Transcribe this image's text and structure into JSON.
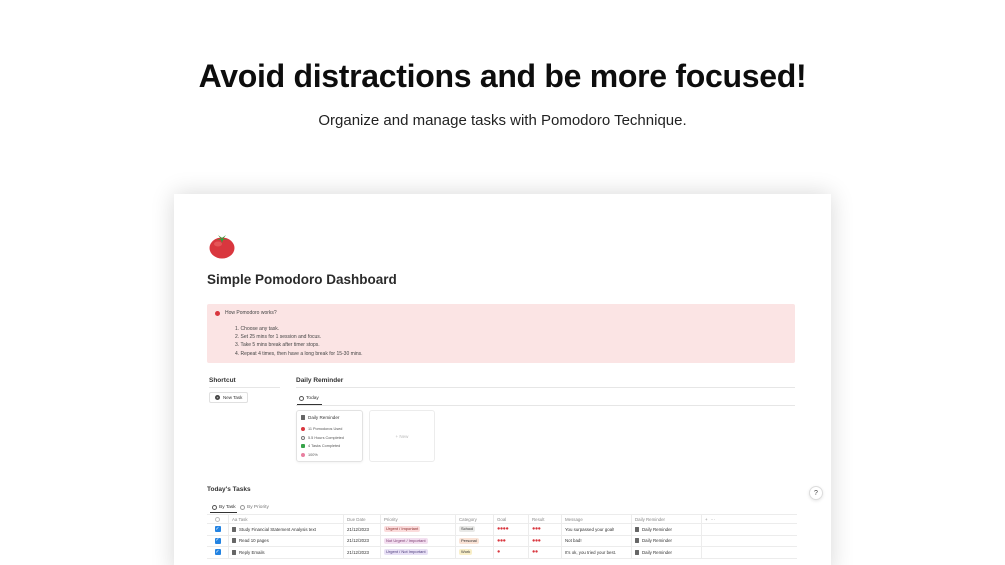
{
  "hero": {
    "title": "Avoid distractions and be more focused!",
    "subtitle": "Organize and manage tasks with Pomodoro Technique."
  },
  "page": {
    "icon": "tomato-icon",
    "title": "Simple Pomodoro Dashboard"
  },
  "callout": {
    "heading": "How Pomodoro works?",
    "steps": [
      "1. Choose any task.",
      "2. Set 25 mins for 1 session and focus.",
      "3. Take 5 mins break after timer stops.",
      "4. Repeat 4 times, then have a long break for 15-30 mins."
    ]
  },
  "shortcut": {
    "label": "Shortcut",
    "new_task": "New Task"
  },
  "daily_reminder": {
    "label": "Daily Reminder",
    "tab": "Today",
    "card": {
      "title": "Daily Reminder",
      "rows": [
        "11 Pomodoros Used",
        "5.5 Hours Completed",
        "4 Tasks Completed",
        "100%"
      ]
    },
    "new_label": "+ New"
  },
  "todays_tasks": {
    "label": "Today's Tasks",
    "tabs": [
      "By Task",
      "By Priority"
    ],
    "columns": [
      "Aa Task",
      "Due Date",
      "Priority",
      "Category",
      "Goal",
      "Result",
      "Message",
      "Daily Reminder"
    ],
    "add": "+",
    "more": "···",
    "rows": [
      {
        "task": "Study Financial Statement Analysis text",
        "due": "21/12/2023",
        "priority": "Urgent / Important",
        "category": "School",
        "goal": "●●●●",
        "result": "●●●",
        "message": "You surpassed your goal!",
        "reminder": "Daily Reminder"
      },
      {
        "task": "Read 10 pages",
        "due": "21/12/2023",
        "priority": "Not Urgent / Important",
        "category": "Personal",
        "goal": "●●●",
        "result": "●●●",
        "message": "Not bad!",
        "reminder": "Daily Reminder"
      },
      {
        "task": "Reply Emails",
        "due": "21/12/2023",
        "priority": "Urgent / Not Important",
        "category": "Work",
        "goal": "●",
        "result": "●●",
        "message": "It's ok, you tried your best.",
        "reminder": "Daily Reminder"
      }
    ]
  },
  "help": "?",
  "colors": {
    "accent_red": "#d9363e",
    "callout_bg": "#fbe4e4",
    "checkbox_blue": "#2383e2"
  }
}
